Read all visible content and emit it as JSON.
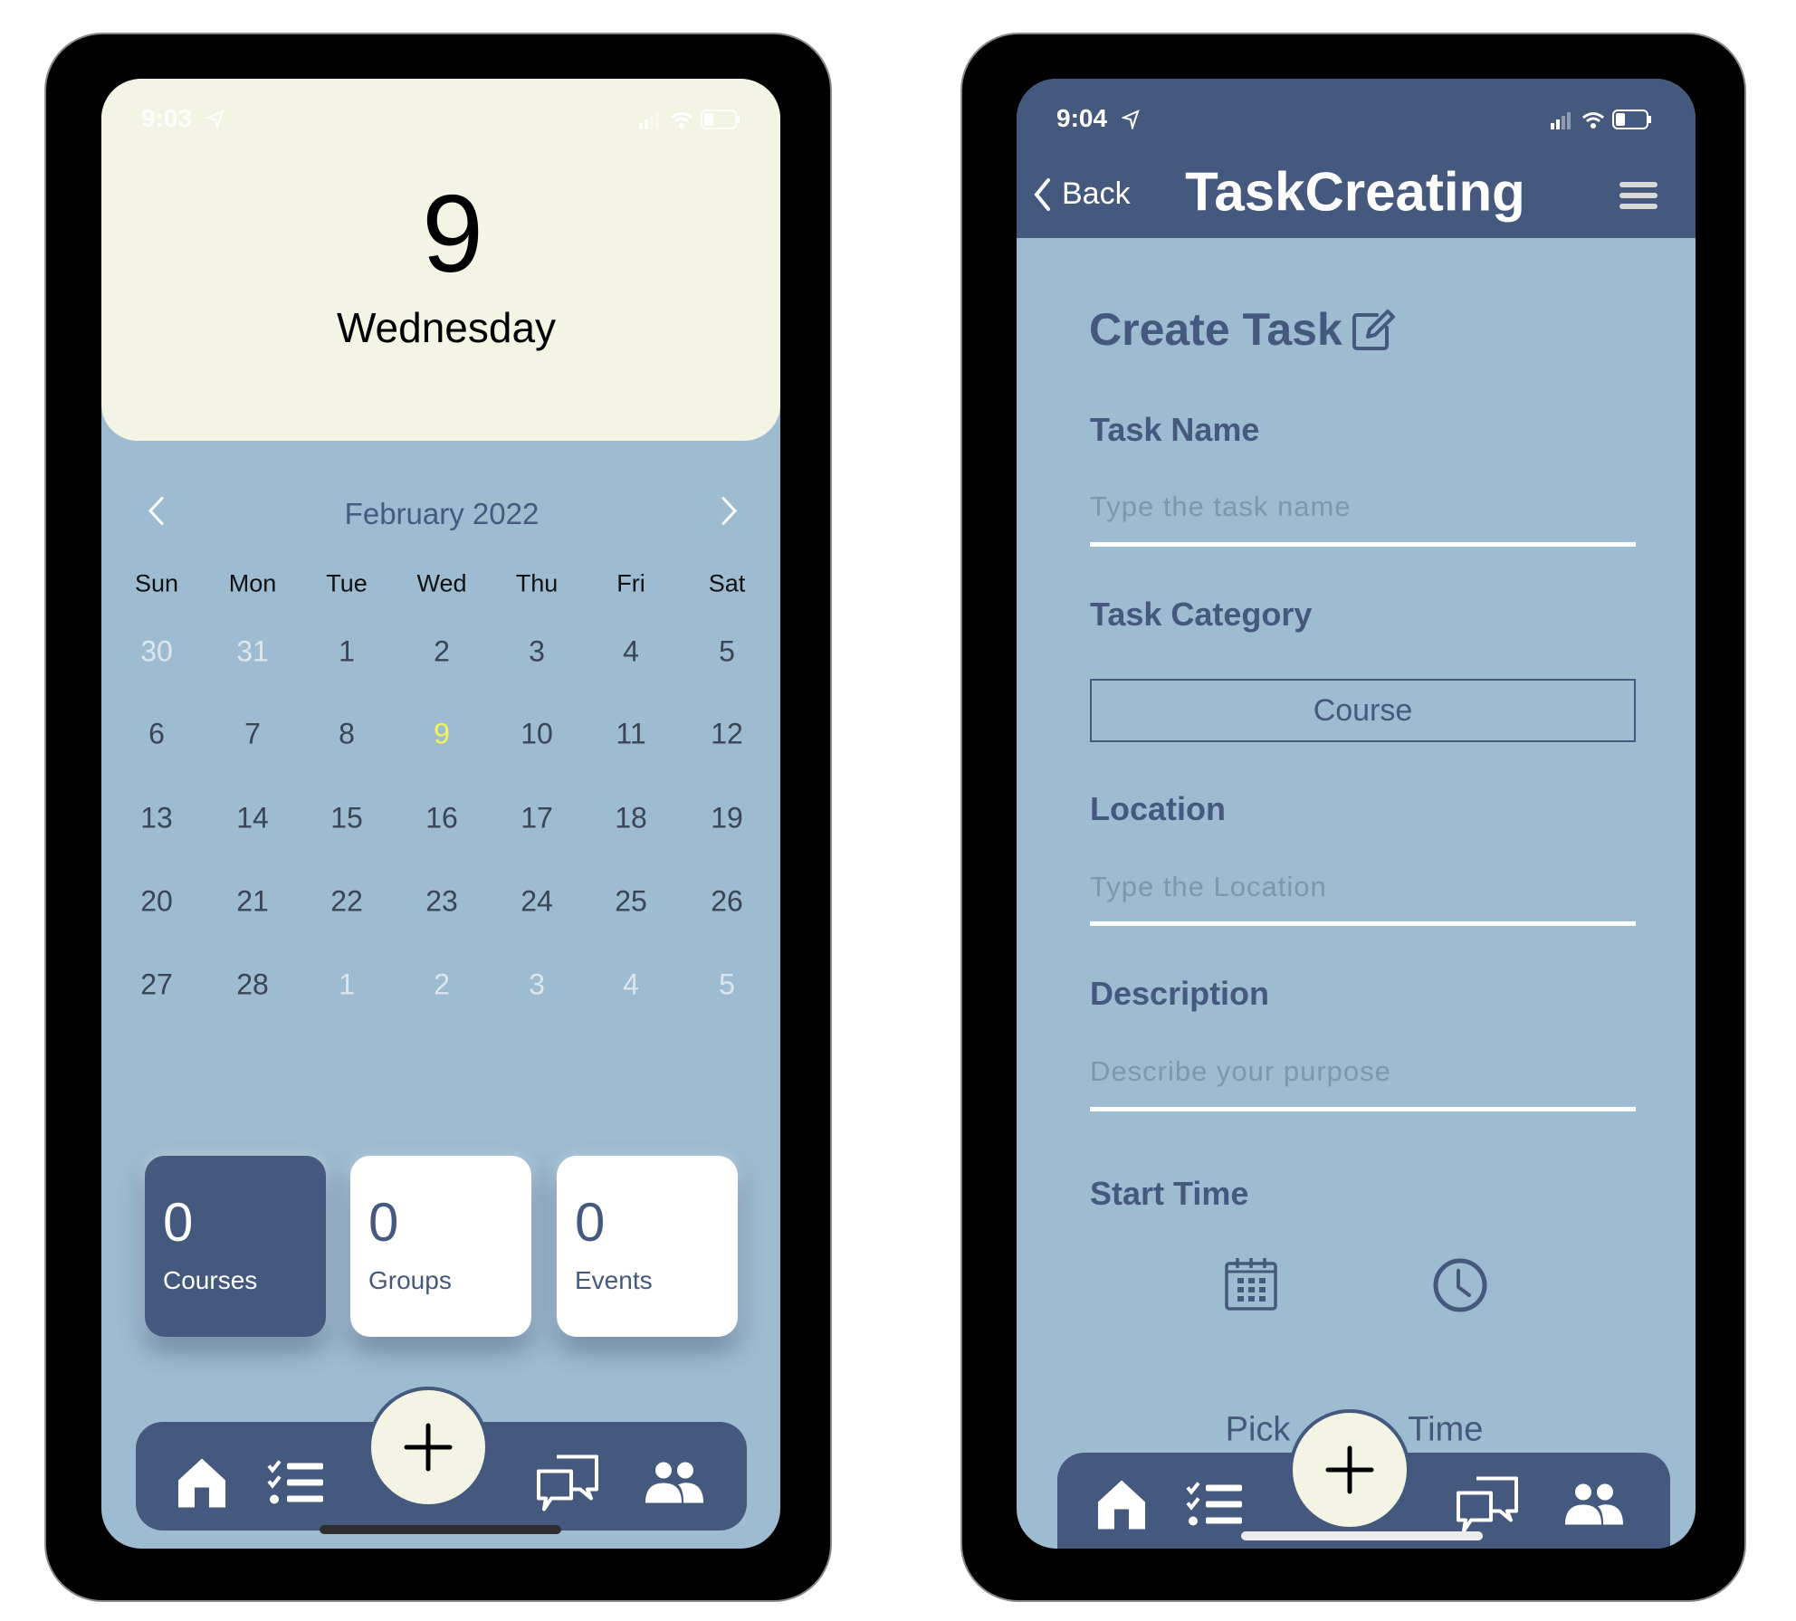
{
  "left_phone": {
    "status_bar": {
      "time": "9:03"
    },
    "header": {
      "day_number": "9",
      "weekday": "Wednesday"
    },
    "calendar": {
      "month_label": "February 2022",
      "prev_icon": "chevron-left-icon",
      "next_icon": "chevron-right-icon",
      "weekdays": [
        "Sun",
        "Mon",
        "Tue",
        "Wed",
        "Thu",
        "Fri",
        "Sat"
      ],
      "weeks": [
        [
          {
            "d": "30",
            "muted": true
          },
          {
            "d": "31",
            "muted": true
          },
          {
            "d": "1"
          },
          {
            "d": "2"
          },
          {
            "d": "3"
          },
          {
            "d": "4"
          },
          {
            "d": "5"
          }
        ],
        [
          {
            "d": "6"
          },
          {
            "d": "7"
          },
          {
            "d": "8"
          },
          {
            "d": "9",
            "today": true
          },
          {
            "d": "10"
          },
          {
            "d": "11"
          },
          {
            "d": "12"
          }
        ],
        [
          {
            "d": "13"
          },
          {
            "d": "14"
          },
          {
            "d": "15"
          },
          {
            "d": "16"
          },
          {
            "d": "17"
          },
          {
            "d": "18"
          },
          {
            "d": "19"
          }
        ],
        [
          {
            "d": "20"
          },
          {
            "d": "21"
          },
          {
            "d": "22"
          },
          {
            "d": "23"
          },
          {
            "d": "24"
          },
          {
            "d": "25"
          },
          {
            "d": "26"
          }
        ],
        [
          {
            "d": "27"
          },
          {
            "d": "28"
          },
          {
            "d": "1",
            "muted": true
          },
          {
            "d": "2",
            "muted": true
          },
          {
            "d": "3",
            "muted": true
          },
          {
            "d": "4",
            "muted": true
          },
          {
            "d": "5",
            "muted": true
          }
        ]
      ],
      "today_color": "#f5f55b"
    },
    "stats": [
      {
        "count": "0",
        "label": "Courses",
        "active": true
      },
      {
        "count": "0",
        "label": "Groups",
        "active": false
      },
      {
        "count": "0",
        "label": "Events",
        "active": false
      }
    ]
  },
  "right_phone": {
    "status_bar": {
      "time": "9:04"
    },
    "nav": {
      "back_label": "Back",
      "title": "TaskCreating",
      "menu_icon": "hamburger-menu-icon"
    },
    "form": {
      "title": "Create Task",
      "title_icon": "edit-icon",
      "task_name": {
        "label": "Task Name",
        "value": "",
        "placeholder": "Type the task name"
      },
      "task_category": {
        "label": "Task Category",
        "selected": "Course"
      },
      "location": {
        "label": "Location",
        "value": "",
        "placeholder": "Type the Location"
      },
      "description": {
        "label": "Description",
        "value": "",
        "placeholder": "Describe your purpose"
      },
      "start_time": {
        "label": "Start Time",
        "date_icon": "calendar-icon",
        "time_icon": "clock-icon"
      },
      "pick_time_label": "Pick Time"
    }
  },
  "tab_bar": {
    "items": [
      "home-icon",
      "task-list-icon",
      "add-icon",
      "chat-icon",
      "people-icon"
    ]
  },
  "colors": {
    "primary": "#44597d",
    "background": "#9dbbd1",
    "cream": "#f3f4e3",
    "white": "#ffffff"
  }
}
